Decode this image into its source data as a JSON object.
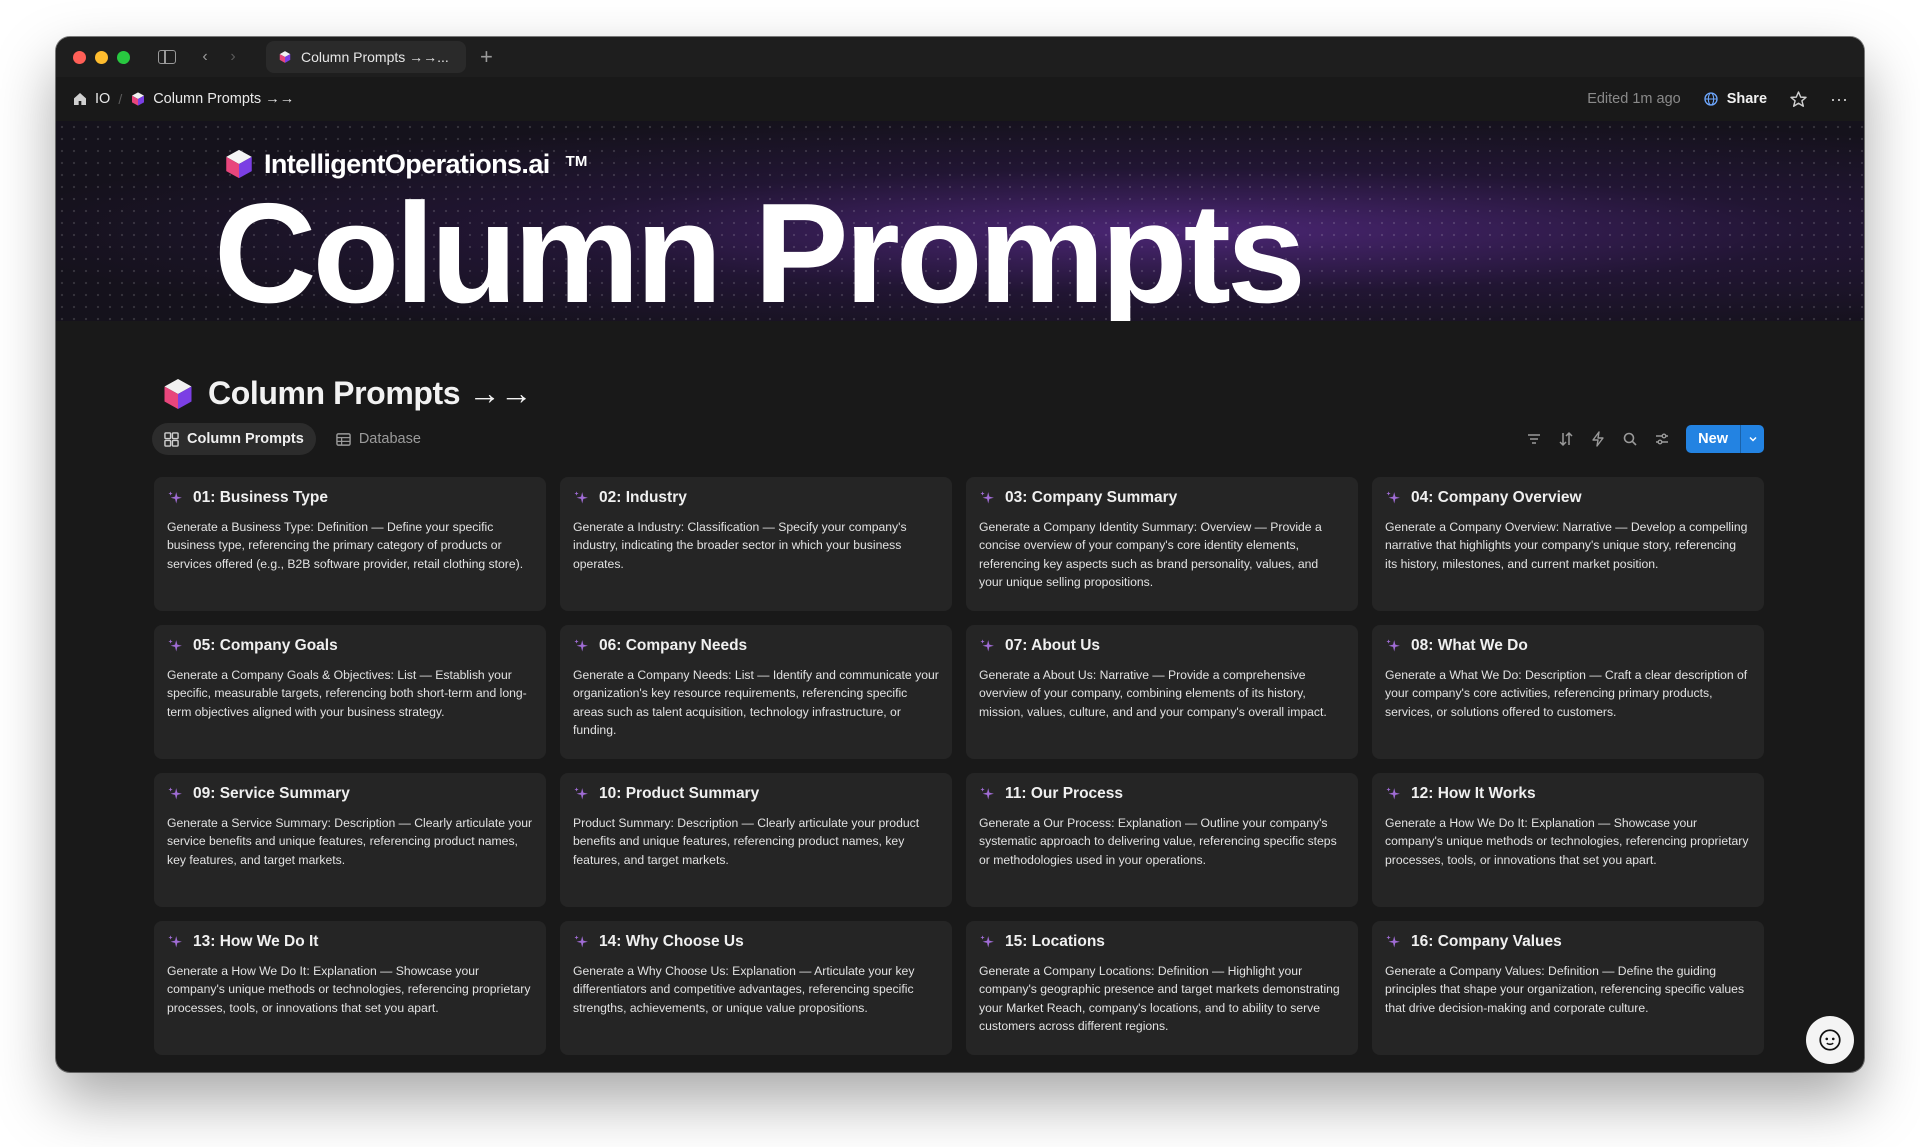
{
  "browser": {
    "tab_title": "Column Prompts →→...",
    "new_tab": "+",
    "back": "‹",
    "forward": "›"
  },
  "breadcrumb": {
    "root": "IO",
    "separator": "/",
    "page": "Column Prompts →→"
  },
  "topbar": {
    "edited": "Edited 1m ago",
    "share": "Share",
    "more": "···"
  },
  "cover": {
    "brand": "IntelligentOperations.ai",
    "tm": "TM",
    "title": "Column Prompts"
  },
  "page": {
    "title": "Column Prompts →→"
  },
  "views": [
    {
      "label": "Column Prompts",
      "icon": "gallery-icon",
      "active": true
    },
    {
      "label": "Database",
      "icon": "table-icon",
      "active": false
    }
  ],
  "toolbar": {
    "new_label": "New"
  },
  "cards": [
    {
      "title": "01: Business Type",
      "desc": "Generate a Business Type: Definition — Define your specific business type, referencing the primary category of products or services offered (e.g., B2B software provider, retail clothing store)."
    },
    {
      "title": "02: Industry",
      "desc": "Generate a Industry: Classification — Specify your company's industry, indicating the broader sector in which your business operates."
    },
    {
      "title": "03: Company Summary",
      "desc": "Generate a Company Identity Summary: Overview — Provide a concise overview of your company's core identity elements, referencing key aspects such as brand personality, values, and your unique selling propositions."
    },
    {
      "title": "04: Company Overview",
      "desc": "Generate a Company Overview: Narrative — Develop a compelling narrative that highlights your company's unique story, referencing its history, milestones, and current market position."
    },
    {
      "title": "05: Company Goals",
      "desc": "Generate a Company Goals & Objectives: List — Establish your specific, measurable targets, referencing both short-term and long-term objectives aligned with your business strategy."
    },
    {
      "title": "06: Company Needs",
      "desc": "Generate a Company Needs: List — Identify and communicate your organization's key resource requirements, referencing specific areas such as talent acquisition, technology infrastructure, or funding."
    },
    {
      "title": "07: About Us",
      "desc": "Generate a About Us: Narrative — Provide a comprehensive overview of your company, combining elements of its history, mission, values, culture, and and your company's overall impact."
    },
    {
      "title": "08: What We Do",
      "desc": "Generate a What We Do: Description — Craft a clear description of your company's core activities, referencing primary products, services, or solutions offered to customers."
    },
    {
      "title": "09: Service Summary",
      "desc": "Generate a Service Summary: Description — Clearly articulate your service benefits and unique features, referencing product names, key features, and target markets."
    },
    {
      "title": "10: Product Summary",
      "desc": "Product Summary: Description — Clearly articulate your product benefits and unique features, referencing product names, key features, and target markets."
    },
    {
      "title": "11: Our Process",
      "desc": "Generate a Our Process: Explanation — Outline your company's systematic approach to delivering value, referencing specific steps or methodologies used in your operations."
    },
    {
      "title": "12: How It Works",
      "desc": "Generate a How We Do It: Explanation — Showcase your company's unique methods or technologies, referencing proprietary processes, tools, or innovations that set you apart."
    },
    {
      "title": "13: How We Do It",
      "desc": "Generate a How We Do It: Explanation — Showcase your company's unique methods or technologies, referencing proprietary processes, tools, or innovations that set you apart."
    },
    {
      "title": "14: Why Choose Us",
      "desc": "Generate a Why Choose Us: Explanation — Articulate your key differentiators and competitive advantages, referencing specific strengths, achievements, or unique value propositions."
    },
    {
      "title": "15: Locations",
      "desc": "Generate a Company Locations: Definition — Highlight your company's geographic presence and target markets demonstrating your Market Reach, company's locations, and to ability to serve customers across different regions."
    },
    {
      "title": "16: Company Values",
      "desc": "Generate a Company Values: Definition — Define the guiding principles that shape your organization, referencing specific values that drive decision-making and corporate culture."
    }
  ],
  "colors": {
    "accent": "#2383e2",
    "background": "#191919",
    "card": "#252525",
    "sparkle": "#a06cd5"
  }
}
